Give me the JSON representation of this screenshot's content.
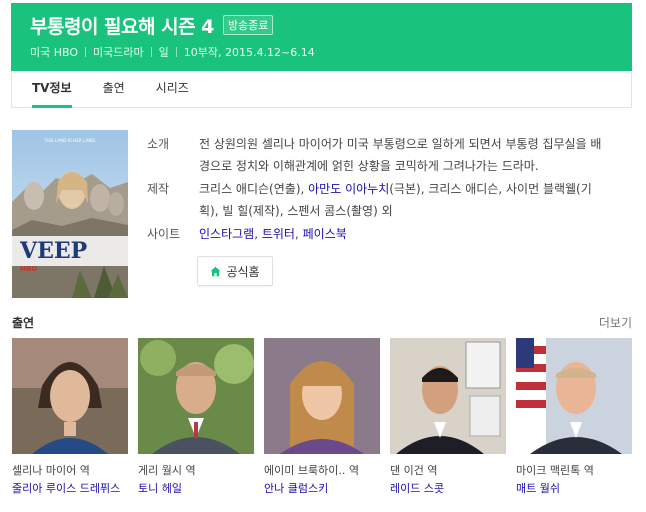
{
  "header": {
    "title": "부통령이 필요해 시즌 4",
    "badge": "방송종료",
    "meta": [
      "미국 HBO",
      "미국드라마",
      "일",
      "10부작, 2015.4.12~6.14"
    ]
  },
  "tabs": [
    {
      "label": "TV정보",
      "active": true
    },
    {
      "label": "출연",
      "active": false
    },
    {
      "label": "시리즈",
      "active": false
    }
  ],
  "poster": {
    "tagline": "THIS LAND IS HER LAND.",
    "logo": "VEEP",
    "network": "HBO"
  },
  "info": {
    "synopsis_label": "소개",
    "synopsis": "전 상원의원 셀리나 마이어가 미국 부통령으로 일하게 되면서 부통령 집무실을 배경으로 정치와 이해관계에 얽힌 상황을 코믹하게 그려나가는 드라마.",
    "production_label": "제작",
    "production": {
      "p1": "크리스 애디슨(연출), ",
      "l1": "아만도 이아누치",
      "p2": "(극본), 크리스 애디슨, 사이먼 블랙웰(기획), 빌 힐(제작), 스펜서 콤스(촬영) 외"
    },
    "site_label": "사이트",
    "sites": [
      "인스타그램",
      "트위터",
      "페이스북"
    ],
    "site_sep": ", ",
    "home_button": "공식홈"
  },
  "cast_section": {
    "title": "출연",
    "more": "더보기",
    "members": [
      {
        "role": "셀리나 마이어 역",
        "actor": "줄리아 루이스 드레퓌스"
      },
      {
        "role": "게리 월시 역",
        "actor": "토니 헤일"
      },
      {
        "role": "에이미 브룩하이.. 역",
        "actor": "안나 클럼스키"
      },
      {
        "role": "댄 이건 역",
        "actor": "레이드 스콧"
      },
      {
        "role": "마이크 맥린톡 역",
        "actor": "매트 월쉬"
      }
    ]
  },
  "colors": {
    "accent": "#19c37d",
    "link": "#1a0dab"
  }
}
